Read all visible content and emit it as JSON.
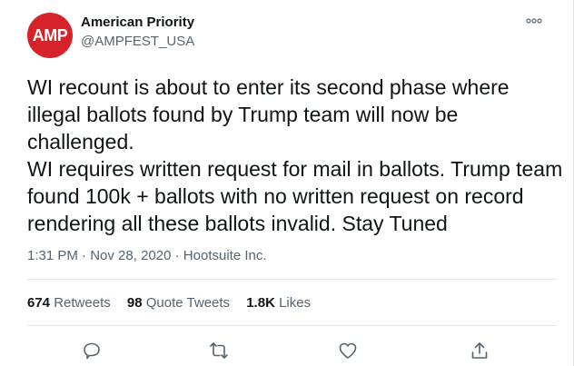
{
  "author": {
    "name": "American Priority",
    "handle": "@AMPFEST_USA",
    "avatar_text": "AMP"
  },
  "tweet": {
    "lines": [
      "WI recount is about to enter its second phase where",
      "illegal ballots found by Trump team will now be",
      "challenged.",
      "WI requires written request for mail in ballots. Trump team",
      "found 100k + ballots with no written request on record",
      "rendering all these ballots invalid. Stay Tuned"
    ],
    "time": "1:31 PM",
    "date": "Nov 28, 2020",
    "source": "Hootsuite Inc.",
    "separator": "·"
  },
  "stats": {
    "retweets": {
      "count": "674",
      "label": "Retweets"
    },
    "quote_tweets": {
      "count": "98",
      "label": "Quote Tweets"
    },
    "likes": {
      "count": "1.8K",
      "label": "Likes"
    }
  },
  "icons": {
    "more": "more-icon",
    "reply": "reply-icon",
    "retweet": "retweet-icon",
    "like": "like-icon",
    "share": "share-icon"
  },
  "colors": {
    "avatar_bg": "#d7212b",
    "text": "#0f1419",
    "muted": "#536471",
    "border": "#e1e8ed"
  }
}
